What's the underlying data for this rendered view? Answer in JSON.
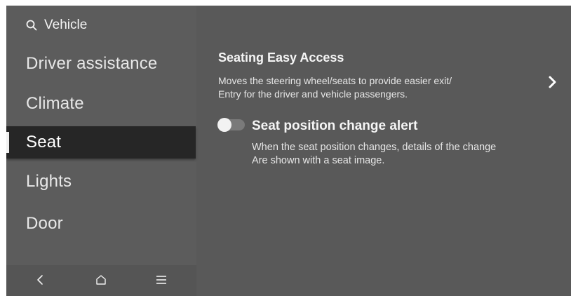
{
  "search": {
    "icon": "search-icon",
    "label": "Vehicle"
  },
  "sidebar": {
    "items": [
      {
        "label": "Driver assistance",
        "active": false
      },
      {
        "label": "Climate",
        "active": false
      },
      {
        "label": "Seat",
        "active": true
      },
      {
        "label": "Lights",
        "active": false
      },
      {
        "label": "Door",
        "active": false
      }
    ]
  },
  "bottom_bar": {
    "back_icon": "chevron-left-icon",
    "home_icon": "home-icon",
    "menu_icon": "hamburger-menu-icon"
  },
  "settings": {
    "easy_access": {
      "title": "Seating Easy Access",
      "description_line1": "Moves the steering wheel/seats to provide easier exit/",
      "description_line2": "Entry for the driver and vehicle passengers.",
      "icon": "chevron-right-icon"
    },
    "position_alert": {
      "title": "Seat position change alert",
      "enabled": false,
      "description_line1": "When the seat position changes, details of the change",
      "description_line2": "Are shown with a seat image."
    }
  }
}
